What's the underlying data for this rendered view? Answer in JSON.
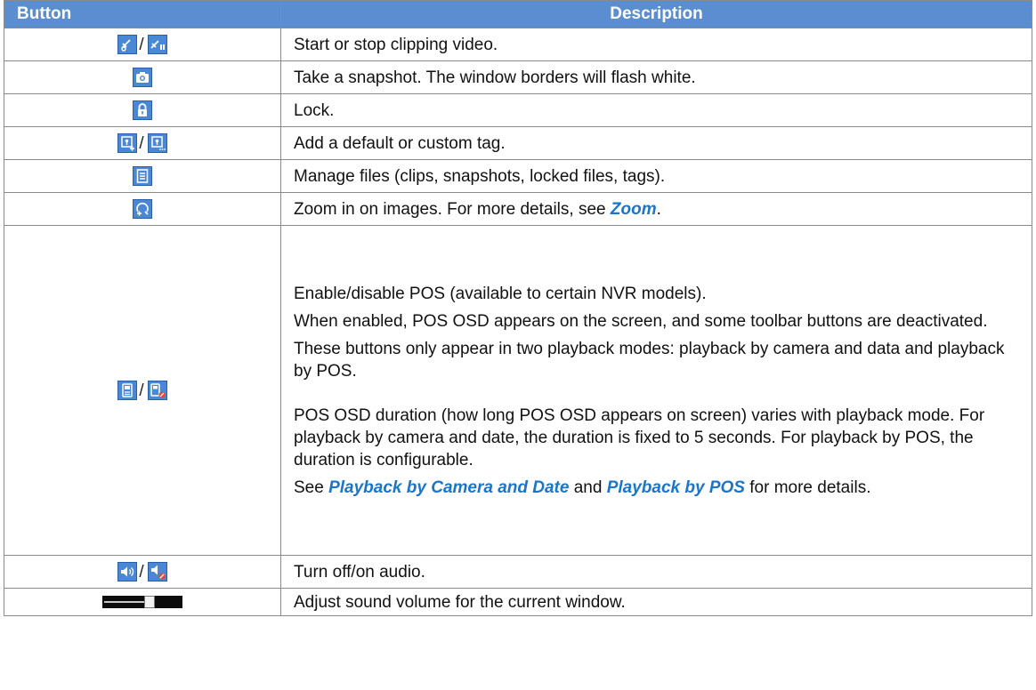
{
  "table": {
    "headers": {
      "button": "Button",
      "description": "Description"
    },
    "rows": [
      {
        "description": "Start or stop clipping video."
      },
      {
        "description": "Take a snapshot. The window borders will flash white."
      },
      {
        "description": "Lock."
      },
      {
        "description": "Add a default or custom tag."
      },
      {
        "description": "Manage files (clips, snapshots, locked files, tags)."
      },
      {
        "description_prefix": "Zoom in on images. For more details, see ",
        "link": "Zoom",
        "description_suffix": "."
      },
      {
        "p1": "Enable/disable POS (available to certain NVR models).",
        "p2": "When enabled, POS OSD appears on the screen, and some toolbar buttons are deactivated.",
        "p3": "These buttons only appear in two playback modes: playback by camera and data and playback by POS.",
        "p4": "POS OSD duration (how long POS OSD appears on screen) varies with playback mode. For playback by camera and date, the duration is fixed to 5 seconds. For playback by POS, the duration is configurable.",
        "p5_prefix": "See ",
        "p5_link1": "Playback by Camera and Date",
        "p5_mid": " and ",
        "p5_link2": "Playback by POS",
        "p5_suffix": " for more details."
      },
      {
        "description": "Turn off/on audio."
      },
      {
        "description": "Adjust sound volume for the current window.",
        "slider_level": 0.6
      }
    ],
    "icons": {
      "row1": [
        "clip-start-icon",
        "clip-stop-icon"
      ],
      "row2": [
        "camera-snapshot-icon"
      ],
      "row3": [
        "lock-icon"
      ],
      "row4": [
        "add-tag-icon",
        "custom-tag-icon"
      ],
      "row5": [
        "file-manage-icon"
      ],
      "row6": [
        "zoom-icon"
      ],
      "row7": [
        "pos-enable-icon",
        "pos-disable-icon"
      ],
      "row8": [
        "audio-on-icon",
        "audio-off-icon"
      ]
    },
    "slash": "/"
  },
  "colors": {
    "header_bg": "#5b8ed0",
    "icon_bg": "#4a87d4",
    "link": "#1b75c9",
    "border": "#8a8a8a"
  }
}
